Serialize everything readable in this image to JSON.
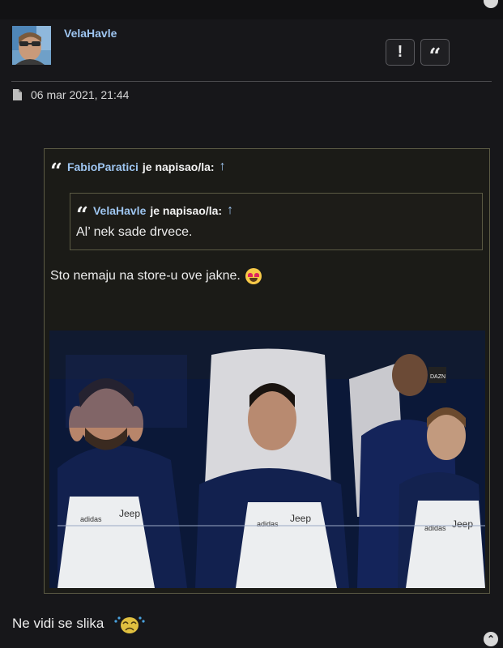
{
  "post": {
    "username": "VelaHavle",
    "date": "06 mar 2021, 21:44",
    "buttons": {
      "report_icon": "!",
      "quote_icon": "“"
    }
  },
  "quote_outer": {
    "author": "FabioParatici",
    "wrote": "je napisao/la:",
    "arrow": "↑",
    "text": "Sto nemaju na store-u ove jakne."
  },
  "quote_inner": {
    "author": "VelaHavle",
    "wrote": "je napisao/la:",
    "arrow": "↑",
    "text": "Al’ nek sade drvece."
  },
  "image": {
    "logo_text": "Jeep",
    "brand_text": "adidas",
    "broadcaster_text": "DAZN"
  },
  "reply": {
    "text": "Ne vidi se slika"
  },
  "icons": {
    "quote_mark": "“",
    "scroll_up": "⌃"
  },
  "colors": {
    "background": "#17171a",
    "link": "#9ec5f0",
    "quote_border": "#5b5a44",
    "quote_bg": "#1b1b17"
  }
}
